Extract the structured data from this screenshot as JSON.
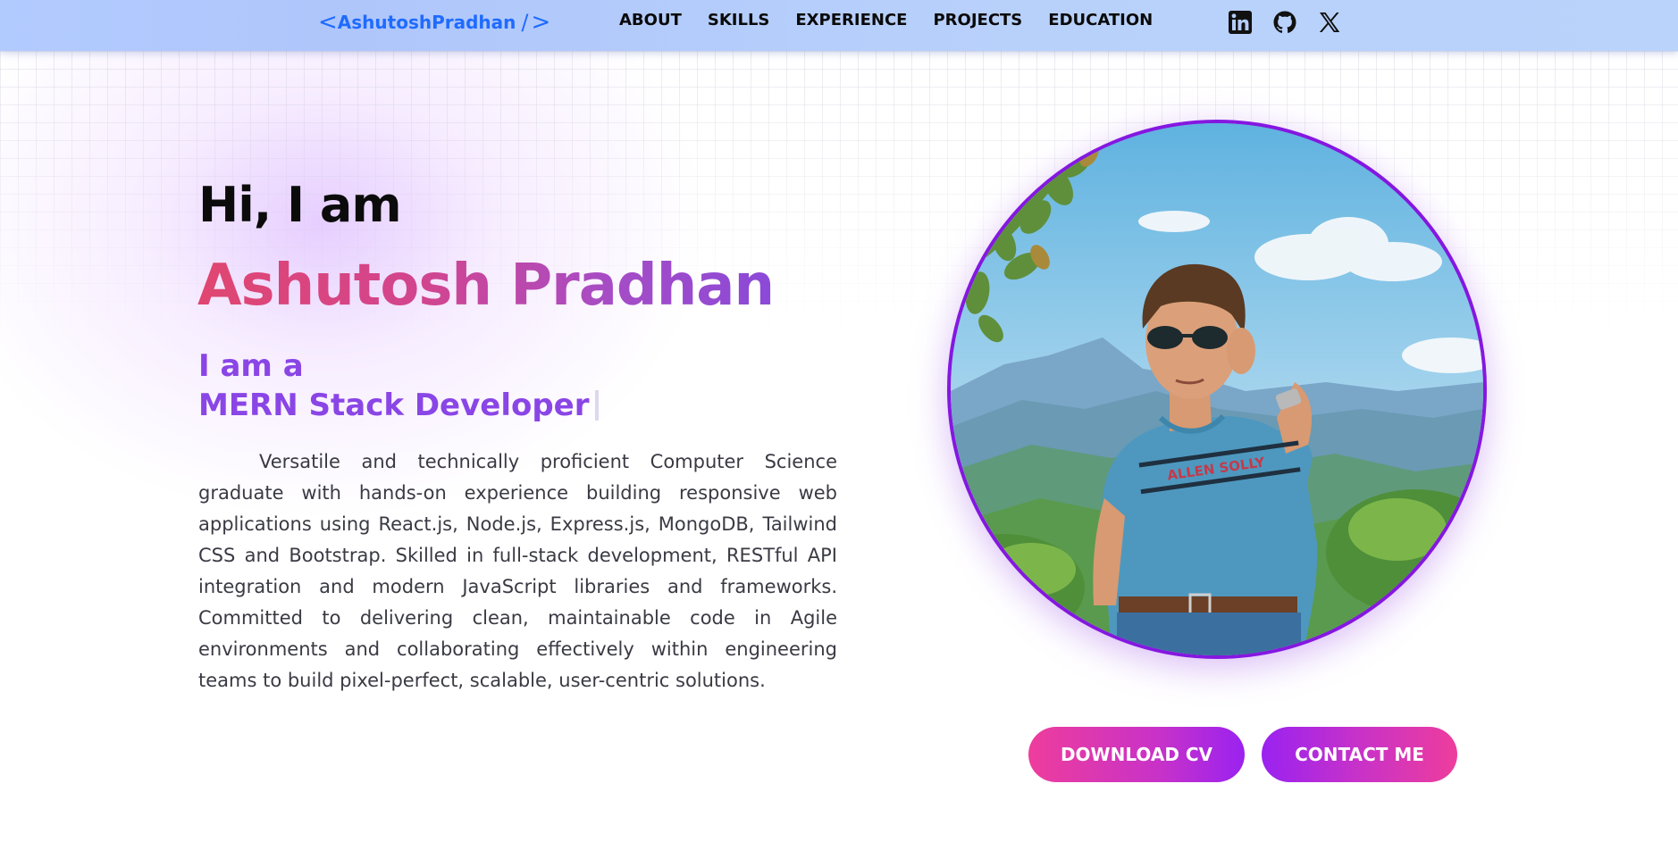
{
  "brand": {
    "open": "<",
    "name": "AshutoshPradhan",
    "slash": "/",
    "close": ">"
  },
  "nav": {
    "links": [
      "ABOUT",
      "SKILLS",
      "EXPERIENCE",
      "PROJECTS",
      "EDUCATION"
    ]
  },
  "socials": {
    "icons": [
      "linkedin-icon",
      "github-icon",
      "x-icon"
    ]
  },
  "hero": {
    "greeting": "Hi, I am",
    "name": "Ashutosh Pradhan",
    "role_prefix": "I am a",
    "role": "MERN Stack Developer",
    "bio": "Versatile and technically proficient Computer Science graduate with hands-on experience building responsive web applications using React.js, Node.js, Express.js, MongoDB, Tailwind CSS and Bootstrap. Skilled in full-stack development, RESTful API integration and modern JavaScript libraries and frameworks. Committed to delivering clean, maintainable code in Agile environments and collaborating effectively within engineering teams to build pixel-perfect, scalable, user-centric solutions.",
    "shirt_text": "ALLEN SOLLY"
  },
  "buttons": {
    "download_cv": "DOWNLOAD CV",
    "contact_me": "CONTACT ME"
  },
  "colors": {
    "navbar": "#b4cdfb",
    "brand_blue": "#1f6bff",
    "accent_purple": "#8a45e6",
    "portrait_border": "#8517e0",
    "button_pink": "#ee3d9c",
    "button_purple": "#9a22f0"
  }
}
